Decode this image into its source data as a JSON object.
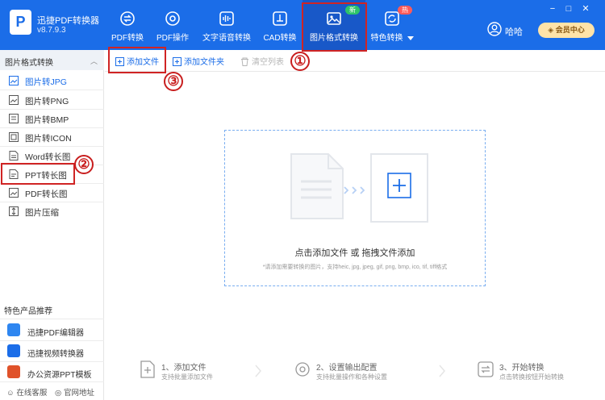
{
  "app": {
    "name": "迅捷PDF转换器",
    "version": "v8.7.9.3",
    "logo": "P"
  },
  "nav": [
    {
      "label": "PDF转换",
      "icon": "convert-icon"
    },
    {
      "label": "PDF操作",
      "icon": "gear-icon"
    },
    {
      "label": "文字语音转换",
      "icon": "audio-wave-icon"
    },
    {
      "label": "CAD转换",
      "icon": "cad-icon"
    },
    {
      "label": "图片格式转换",
      "icon": "image-icon",
      "badge": "新"
    },
    {
      "label": "特色转换",
      "icon": "refresh-icon",
      "badge": "热"
    }
  ],
  "user": {
    "name": "哈哈",
    "member": "会员中心"
  },
  "window": {
    "minimize": "−",
    "maximize": "□",
    "close": "✕"
  },
  "sidebar": {
    "header": "图片格式转换",
    "items": [
      {
        "label": "图片转JPG"
      },
      {
        "label": "图片转PNG"
      },
      {
        "label": "图片转BMP"
      },
      {
        "label": "图片转ICON"
      },
      {
        "label": "Word转长图"
      },
      {
        "label": "PPT转长图"
      },
      {
        "label": "PDF转长图"
      },
      {
        "label": "图片压缩"
      }
    ],
    "recommend_title": "特色产品推荐",
    "recommend": [
      {
        "label": "迅捷PDF编辑器",
        "color": "#2e86f0"
      },
      {
        "label": "迅捷视频转换器",
        "color": "#1b6de8"
      },
      {
        "label": "办公资源PPT模板",
        "color": "#e0522a"
      }
    ],
    "footer": {
      "service": "在线客服",
      "website": "官网地址"
    }
  },
  "toolbar": {
    "add_file": "添加文件",
    "add_folder": "添加文件夹",
    "clear_list": "清空列表"
  },
  "dropzone": {
    "main_text": "点击添加文件 或 拖拽文件添加",
    "hint": "*请添加需要转换的图片，支持heic, jpg, jpeg, gif, png, bmp, ico, tif, tiff格式"
  },
  "steps": [
    {
      "title": "1、添加文件",
      "desc": "支持批量添加文件"
    },
    {
      "title": "2、设置输出配置",
      "desc": "支持批量操作和各种设置"
    },
    {
      "title": "3、开始转换",
      "desc": "点击转换按钮开始转换"
    }
  ],
  "annotations": [
    "①",
    "②",
    "③"
  ],
  "colors": {
    "brand": "#1b6de8",
    "annotation": "#d02424"
  }
}
